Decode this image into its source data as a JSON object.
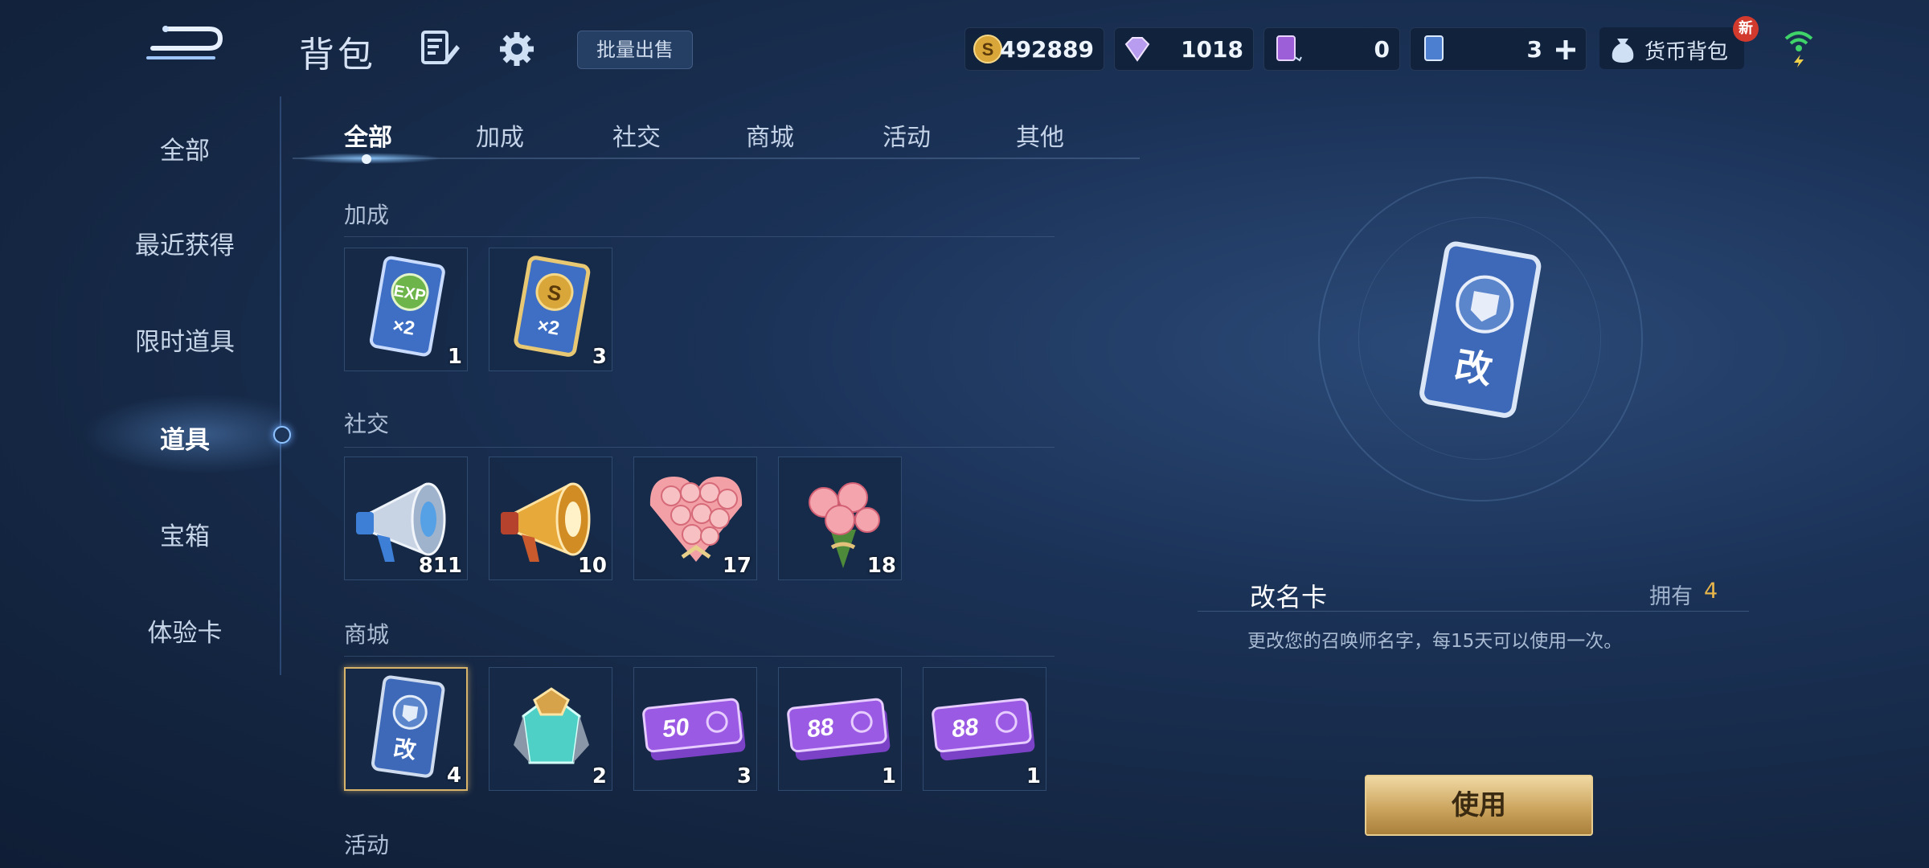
{
  "header": {
    "title": "背包",
    "bulk_sell_label": "批量出售",
    "currency": [
      {
        "icon": "gold-coin-icon",
        "value": "492889"
      },
      {
        "icon": "diamond-icon",
        "value": "1018"
      },
      {
        "icon": "purple-card-icon",
        "value": "0"
      },
      {
        "icon": "blue-card-icon",
        "value": "3"
      }
    ],
    "currency_bag_label": "货币背包",
    "new_badge": "新"
  },
  "sidebar": {
    "items": [
      {
        "label": "全部"
      },
      {
        "label": "最近获得"
      },
      {
        "label": "限时道具"
      },
      {
        "label": "道具"
      },
      {
        "label": "宝箱"
      },
      {
        "label": "体验卡"
      }
    ],
    "active_index": 3
  },
  "tabs": {
    "items": [
      {
        "label": "全部"
      },
      {
        "label": "加成"
      },
      {
        "label": "社交"
      },
      {
        "label": "商城"
      },
      {
        "label": "活动"
      },
      {
        "label": "其他"
      }
    ],
    "active_index": 0
  },
  "sections": {
    "bonus": {
      "title": "加成",
      "items": [
        {
          "icon": "exp-x2-card-icon",
          "count": "1"
        },
        {
          "icon": "gold-x2-card-icon",
          "count": "3"
        }
      ]
    },
    "social": {
      "title": "社交",
      "items": [
        {
          "icon": "blue-megaphone-icon",
          "count": "811"
        },
        {
          "icon": "gold-megaphone-icon",
          "count": "10"
        },
        {
          "icon": "rose-heart-bouquet-icon",
          "count": "17"
        },
        {
          "icon": "rose-bouquet-icon",
          "count": "18"
        }
      ]
    },
    "shop": {
      "title": "商城",
      "items": [
        {
          "icon": "rename-card-icon",
          "count": "4",
          "badge": "改"
        },
        {
          "icon": "crystal-crown-icon",
          "count": "2"
        },
        {
          "icon": "ticket-50-icon",
          "count": "3",
          "badge": "50"
        },
        {
          "icon": "ticket-88-icon",
          "count": "1",
          "badge": "88"
        },
        {
          "icon": "ticket-88-icon",
          "count": "1",
          "badge": "88"
        }
      ]
    },
    "event": {
      "title": "活动"
    }
  },
  "detail": {
    "name": "改名卡",
    "own_label": "拥有",
    "own_count": "4",
    "card_char": "改",
    "description": "更改您的召唤师名字，每15天可以使用一次。",
    "use_label": "使用"
  },
  "colors": {
    "accent_gold": "#e7b54a",
    "selected_border": "#d8b46a",
    "background": "#1b3257"
  }
}
